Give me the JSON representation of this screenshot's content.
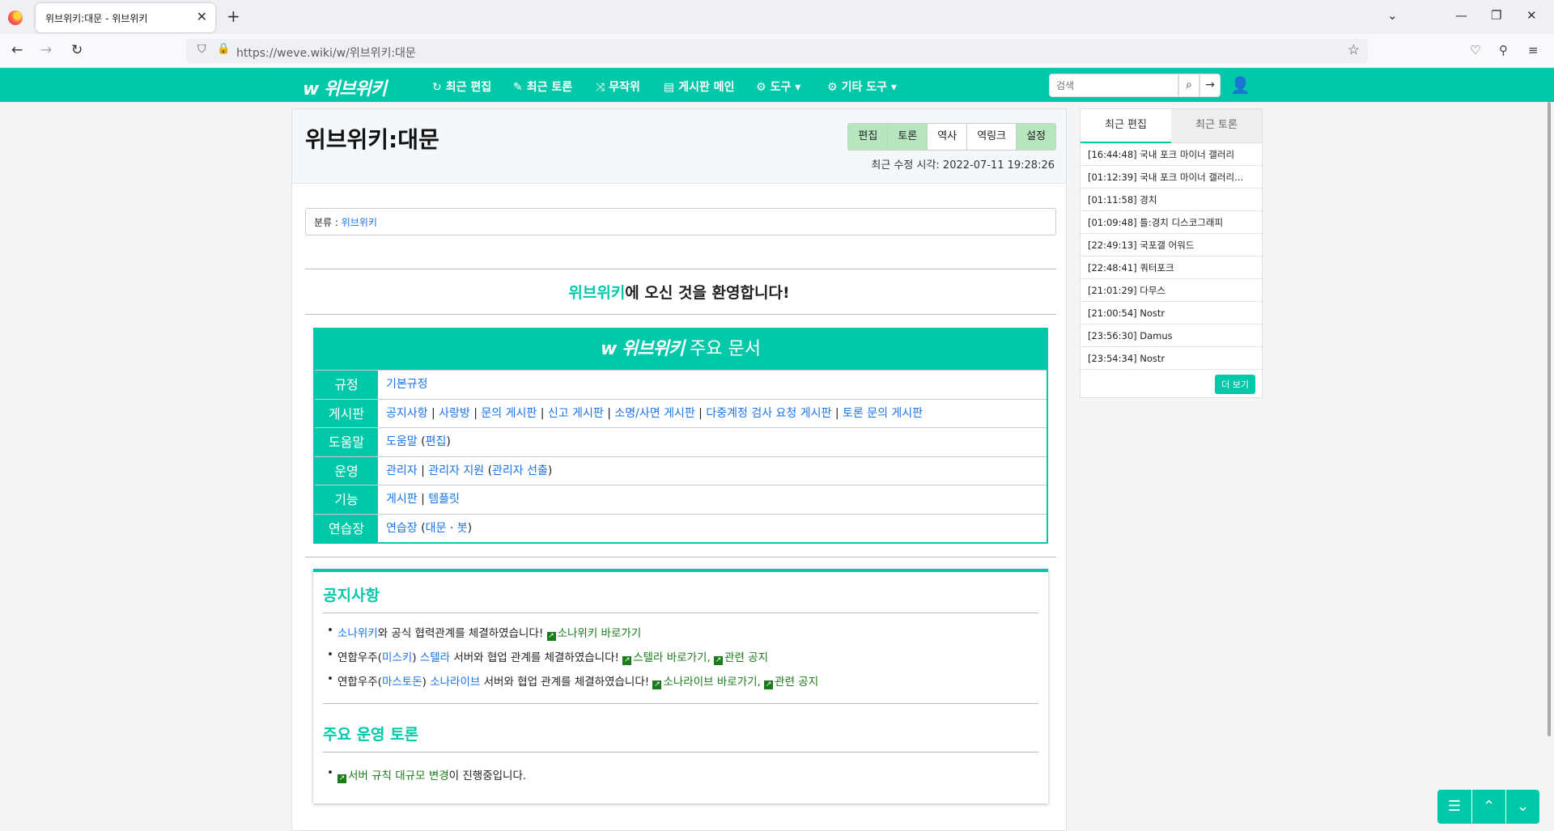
{
  "browser": {
    "tab_title": "위브위키:대문 - 위브위키",
    "url": "https://weve.wiki/w/위브위키:대문",
    "icons": {
      "new_tab": "+",
      "close": "✕",
      "back": "←",
      "forward": "→",
      "reload": "↻",
      "shield": "⛉",
      "lock": "🔒",
      "star": "☆",
      "minimize": "—",
      "restore": "❐",
      "win_close": "✕",
      "dropdown": "⌄",
      "pocket": "♡",
      "extensions": "⚲",
      "menu": "≡"
    }
  },
  "site": {
    "logo": "w 위브위키",
    "menu": [
      {
        "icon": "↻",
        "label": "최근 편집"
      },
      {
        "icon": "✎",
        "label": "최근 토론"
      },
      {
        "icon": "⤨",
        "label": "무작위"
      },
      {
        "icon": "▤",
        "label": "게시판 메인"
      },
      {
        "icon": "⚙",
        "label": "도구 ▾"
      },
      {
        "icon": "⚙",
        "label": "기타 도구 ▾"
      }
    ],
    "search_placeholder": "검색",
    "search_icon": "⌕",
    "go_icon": "→",
    "user_icon": "👤"
  },
  "article": {
    "title": "위브위키:대문",
    "buttons": [
      "편집",
      "토론",
      "역사",
      "역링크",
      "설정"
    ],
    "last_edit": "최근 수정 시각: 2022-07-11 19:28:26",
    "category_label": "분류 : ",
    "category_value": "위브위키",
    "welcome_accent": "위브위키",
    "welcome_rest": "에 오신 것을 환영합니다!",
    "docs_logo": "w 위브위키",
    "docs_title": " 주요 문서",
    "docs_rows": [
      {
        "key": "규정"
      },
      {
        "key": "게시판"
      },
      {
        "key": "도움말"
      },
      {
        "key": "운영"
      },
      {
        "key": "기능"
      },
      {
        "key": "연습장"
      }
    ],
    "docs_links": {
      "r0": "기본규정",
      "r1": [
        "공지사항",
        "사랑방",
        "문의 게시판",
        "신고 게시판",
        "소명/사면 게시판",
        "다중계정 검사 요청 게시판",
        "토론 문의 게시판"
      ],
      "r2": [
        "도움말",
        "편집"
      ],
      "r3": [
        "관리자",
        "관리자 지원",
        "관리자 선출"
      ],
      "r4": [
        "게시판",
        "템플릿"
      ],
      "r5": [
        "연습장",
        "대문",
        "봇"
      ]
    },
    "sep": " | ",
    "notice_title": "공지사항",
    "notice_items": {
      "n1_link": "소나위키",
      "n1_text": "와 공식 협력관계를 체결하였습니다! ",
      "n1_ext": "소나위키 바로가기",
      "n2_pre": "연합우주(",
      "n2_link1": "미스키",
      "n2_mid": ") ",
      "n2_link2": "스텔라",
      "n2_text": " 서버와 협업 관계를 체결하였습니다! ",
      "n2_ext1": "스텔라 바로가기,",
      "n2_ext2": "관련 공지",
      "n3_pre": "연합우주(",
      "n3_link1": "마스토돈",
      "n3_mid": ") ",
      "n3_link2": "소나라이브",
      "n3_text": " 서버와 협업 관계를 체결하였습니다! ",
      "n3_ext1": "소나라이브 바로가기,",
      "n3_ext2": "관련 공지"
    },
    "discussion_title": "주요 운영 토론",
    "discussion_ext": "서버 규칙 대규모 변경",
    "discussion_text": "이 진행중입니다."
  },
  "sidebar": {
    "tabs": [
      "최근 편집",
      "최근 토론"
    ],
    "items": [
      "[16:44:48] 국내 포크 마이너 갤러리",
      "[01:12:39] 국내 포크 마이너 갤러리...",
      "[01:11:58] 경치",
      "[01:09:48] 틀:경치 디스코그래피",
      "[22:49:13] 국포갤 어워드",
      "[22:48:41] 쿼터포크",
      "[21:01:29] 다무스",
      "[21:00:54] Nostr",
      "[23:56:30] Damus",
      "[23:54:34] Nostr"
    ],
    "more": "더 보기"
  },
  "fab": {
    "list": "☰",
    "up": "⌃",
    "down": "⌄"
  },
  "colors": {
    "accent": "#00c8a8",
    "link": "#1a73e8",
    "external": "#1c7b1c"
  }
}
